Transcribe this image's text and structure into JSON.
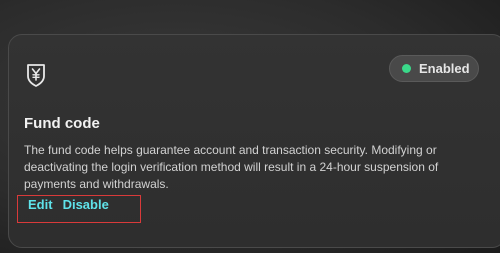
{
  "card": {
    "icon": "shield-yen-icon",
    "title": "Fund code",
    "description": "The fund code helps guarantee account and transaction security. Modifying or deactivating the login verification method will result in a 24-hour suspension of payments and withdrawals.",
    "status": {
      "label": "Enabled",
      "dot_color": "#3ad98a"
    },
    "actions": {
      "edit_label": "Edit",
      "disable_label": "Disable"
    }
  },
  "colors": {
    "accent_link": "#5fe3ea",
    "highlight_border": "#d93a3a"
  }
}
